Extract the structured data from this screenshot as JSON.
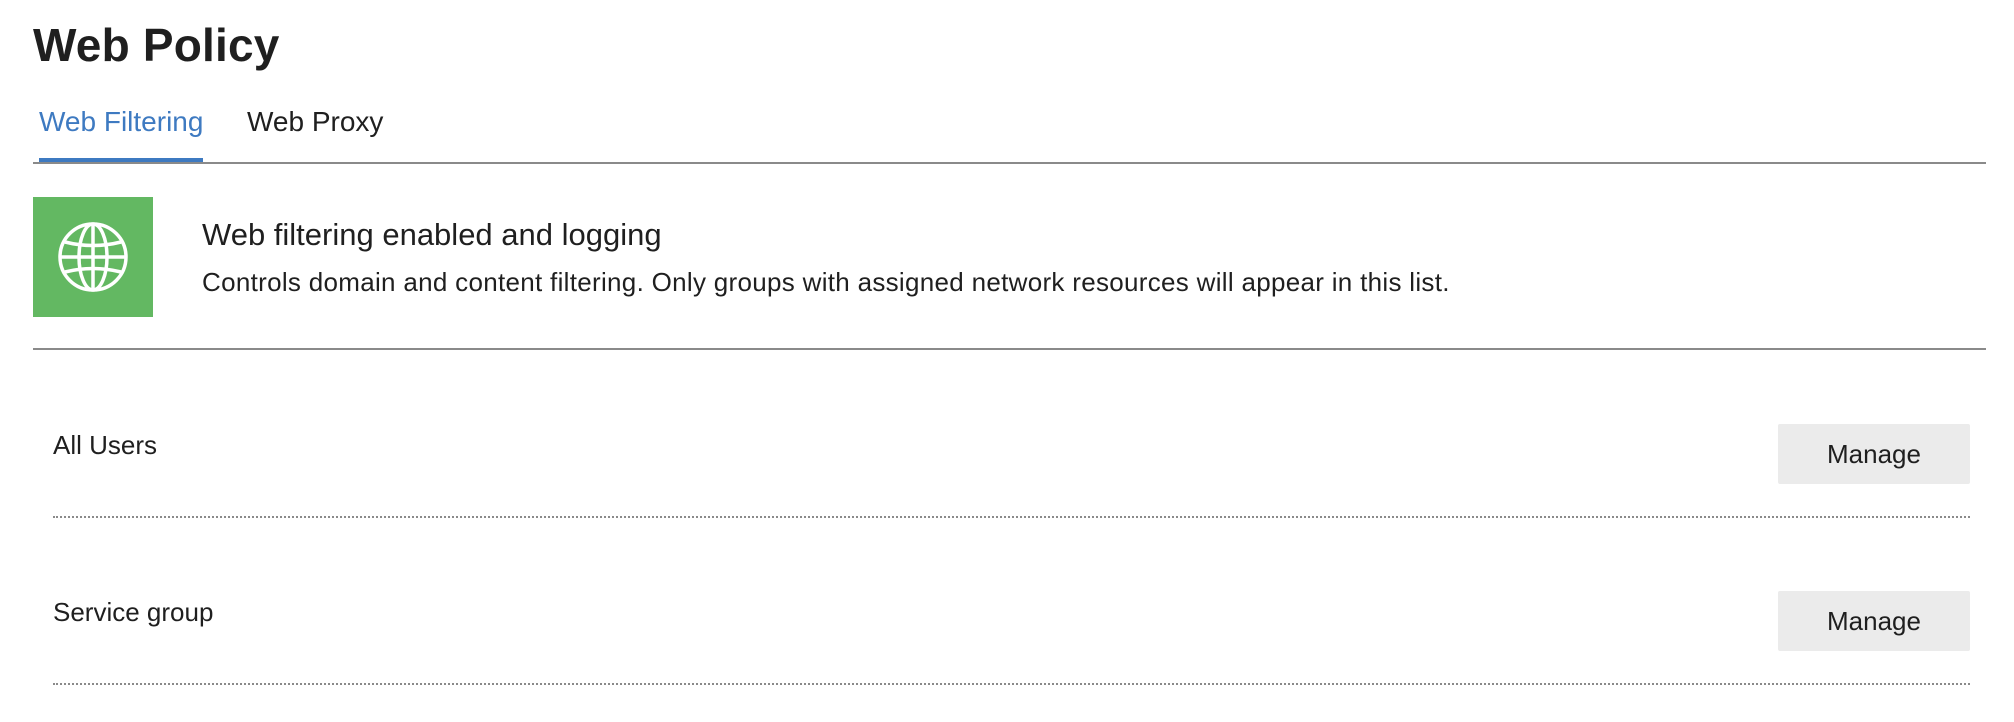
{
  "page": {
    "title": "Web Policy"
  },
  "tabs": [
    {
      "label": "Web Filtering",
      "active": true
    },
    {
      "label": "Web Proxy",
      "active": false
    }
  ],
  "status": {
    "icon": "globe-icon",
    "heading": "Web filtering enabled and logging",
    "description": "Controls domain and content filtering. Only groups with assigned network resources will appear in this list."
  },
  "groups": [
    {
      "name": "All Users",
      "action_label": "Manage"
    },
    {
      "name": "Service group",
      "action_label": "Manage"
    }
  ],
  "colors": {
    "accent": "#3e7ac1",
    "status_green": "#63b862",
    "button_bg": "#ebebeb",
    "text": "#1f1f1f",
    "divider": "#8a8a8a"
  }
}
